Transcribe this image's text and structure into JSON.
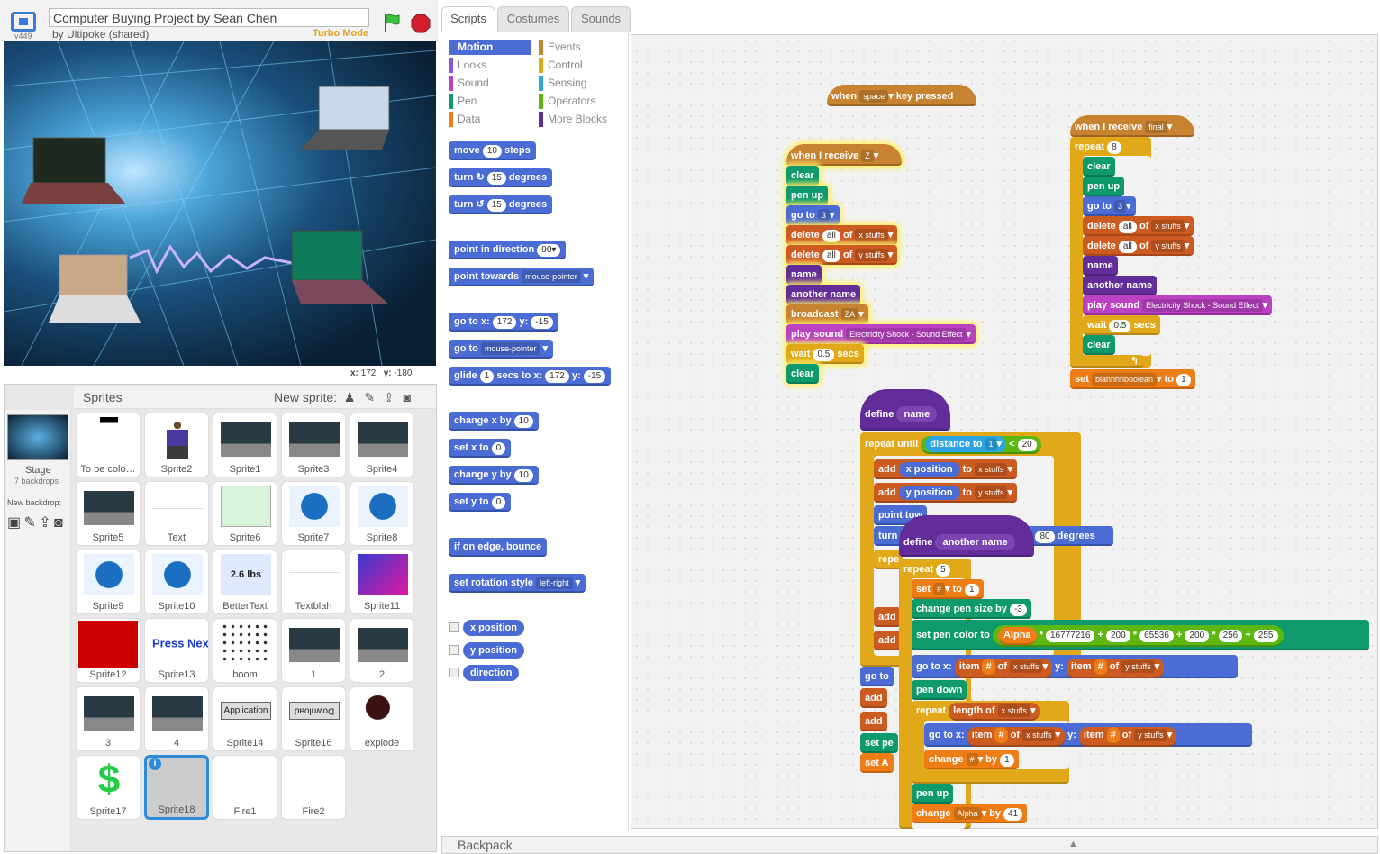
{
  "header": {
    "version": "v449",
    "project_title": "Computer Buying Project by Sean Chen",
    "byline": "by Ultipoke (shared)",
    "turbo": "Turbo Mode"
  },
  "stage": {
    "x_label": "x:",
    "x_value": "172",
    "y_label": "y:",
    "y_value": "-180"
  },
  "sprites_pane": {
    "title": "Sprites",
    "new_sprite": "New sprite:",
    "stage_label": "Stage",
    "backdrops": "7 backdrops",
    "new_backdrop": "New backdrop:",
    "tiles": [
      {
        "label": "To be colo…",
        "thumb": "stick-figure"
      },
      {
        "label": "Sprite2",
        "thumb": "person"
      },
      {
        "label": "Sprite1",
        "thumb": "laptop"
      },
      {
        "label": "Sprite3",
        "thumb": "laptop"
      },
      {
        "label": "Sprite4",
        "thumb": "laptop"
      },
      {
        "label": "Sprite5",
        "thumb": "laptop"
      },
      {
        "label": "Text",
        "thumb": "text"
      },
      {
        "label": "Sprite6",
        "thumb": "doc"
      },
      {
        "label": "Sprite7",
        "thumb": "intel"
      },
      {
        "label": "Sprite8",
        "thumb": "intel"
      },
      {
        "label": "Sprite9",
        "thumb": "intel"
      },
      {
        "label": "Sprite10",
        "thumb": "intel"
      },
      {
        "label": "BetterText",
        "thumb": "text-2.6lbs",
        "text": "2.6 lbs"
      },
      {
        "label": "Textblah",
        "thumb": "text"
      },
      {
        "label": "Sprite11",
        "thumb": "gradient"
      },
      {
        "label": "Sprite12",
        "thumb": "red"
      },
      {
        "label": "Sprite13",
        "thumb": "press-next",
        "text": "Press Next"
      },
      {
        "label": "boom",
        "thumb": "dots"
      },
      {
        "label": "1",
        "thumb": "laptop"
      },
      {
        "label": "2",
        "thumb": "laptop"
      },
      {
        "label": "3",
        "thumb": "laptop"
      },
      {
        "label": "4",
        "thumb": "laptop"
      },
      {
        "label": "Sprite14",
        "thumb": "button-application",
        "text": "Application"
      },
      {
        "label": "Sprite16",
        "thumb": "button-download",
        "text": "Download"
      },
      {
        "label": "explode",
        "thumb": "splat"
      },
      {
        "label": "Sprite17",
        "thumb": "dollar",
        "text": "$"
      },
      {
        "label": "Sprite18",
        "thumb": "selected"
      },
      {
        "label": "Fire1",
        "thumb": "blank"
      },
      {
        "label": "Fire2",
        "thumb": "blank"
      }
    ]
  },
  "tabs": [
    "Scripts",
    "Costumes",
    "Sounds"
  ],
  "categories": [
    {
      "label": "Motion",
      "color": "#4a6cd4"
    },
    {
      "label": "Events",
      "color": "#c88330"
    },
    {
      "label": "Looks",
      "color": "#8a55d7"
    },
    {
      "label": "Control",
      "color": "#e1a91a"
    },
    {
      "label": "Sound",
      "color": "#bb42c3"
    },
    {
      "label": "Sensing",
      "color": "#2ca5e2"
    },
    {
      "label": "Pen",
      "color": "#0e9a6c"
    },
    {
      "label": "Operators",
      "color": "#5cb712"
    },
    {
      "label": "Data",
      "color": "#ee7d16"
    },
    {
      "label": "More Blocks",
      "color": "#632d99"
    }
  ],
  "palette": {
    "move": "move",
    "steps_val": "10",
    "steps": "steps",
    "turn": "turn",
    "turn_r_val": "15",
    "degrees": "degrees",
    "turn_l_val": "15",
    "point_dir": "point in direction",
    "dir_val": "90▾",
    "point_towards": "point towards",
    "mouse_pointer": "mouse-pointer",
    "go_to_x": "go to x:",
    "gx_val": "172",
    "y": "y:",
    "gy_val": "-15",
    "go_to": "go to",
    "glide": "glide",
    "glide_val": "1",
    "secs_to_x": "secs to x:",
    "glx_val": "172",
    "gly_val": "-15",
    "change_x": "change x by",
    "cx_val": "10",
    "set_x": "set x to",
    "sx_val": "0",
    "change_y": "change y by",
    "cy_val": "10",
    "set_y": "set y to",
    "sy_val": "0",
    "bounce": "if on edge, bounce",
    "rot_style": "set rotation style",
    "rot_val": "left-right",
    "rep_x": "x position",
    "rep_y": "y position",
    "rep_dir": "direction"
  },
  "scripts": {
    "key_hat": {
      "when": "when",
      "key": "space",
      "pressed": "key pressed"
    },
    "recv_z": {
      "when": "when I receive",
      "msg": "Z"
    },
    "s1": {
      "clear": "clear",
      "pen_up": "pen up",
      "go_to": "go to",
      "go_val": "3",
      "delete": "delete",
      "all": "all",
      "of": "of",
      "xstuffs": "x stuffs",
      "ystuffs": "y stuffs",
      "name": "name",
      "another_name": "another name",
      "broadcast": "broadcast",
      "bc_val": "ZA",
      "play_sound": "play sound",
      "sound_val": "Electricity Shock - Sound Effect",
      "wait": "wait",
      "wait_val": "0.5",
      "secs": "secs"
    },
    "recv_final": {
      "when": "when I receive",
      "msg": "final"
    },
    "s2": {
      "repeat": "repeat",
      "rep_val": "8",
      "set": "set",
      "var": "blahhhhboolean",
      "to": "to",
      "to_val": "1"
    },
    "def1": {
      "define": "define",
      "param": "name",
      "repeat_until": "repeat until",
      "distance_to": "distance to",
      "dist_target": "1",
      "lt": "<",
      "lt_val": "20",
      "add": "add",
      "x_position": "x position",
      "y_position": "y position",
      "to": "to",
      "point_tow": "point tow",
      "turn": "turn",
      "deg_val": "80",
      "degrees": "degrees",
      "repe": "repe",
      "go_to": "go to",
      "set_pe": "set pe",
      "set_a": "set A",
      "add_short": "add"
    },
    "def2": {
      "define": "define",
      "param": "another name",
      "repeat": "repeat",
      "rep_val": "5",
      "set": "set",
      "hash": "#",
      "to": "to",
      "to_val": "1",
      "change_pen_size": "change pen size by",
      "size_val": "-3",
      "set_pen_color": "set pen color to",
      "alpha": "Alpha",
      "times": "*",
      "c1": "16777216",
      "plus": "+",
      "c2": "200",
      "c3": "65536",
      "c4": "200",
      "c5": "256",
      "c6": "255",
      "go_to_x": "go to x:",
      "item": "item",
      "of": "of",
      "xstuffs": "x stuffs",
      "y": "y:",
      "ystuffs": "y stuffs",
      "pen_down": "pen down",
      "length_of": "length of",
      "change": "change",
      "by": "by",
      "by_val": "1",
      "pen_up": "pen up",
      "alpha_by": "41"
    }
  },
  "backpack": "Backpack"
}
